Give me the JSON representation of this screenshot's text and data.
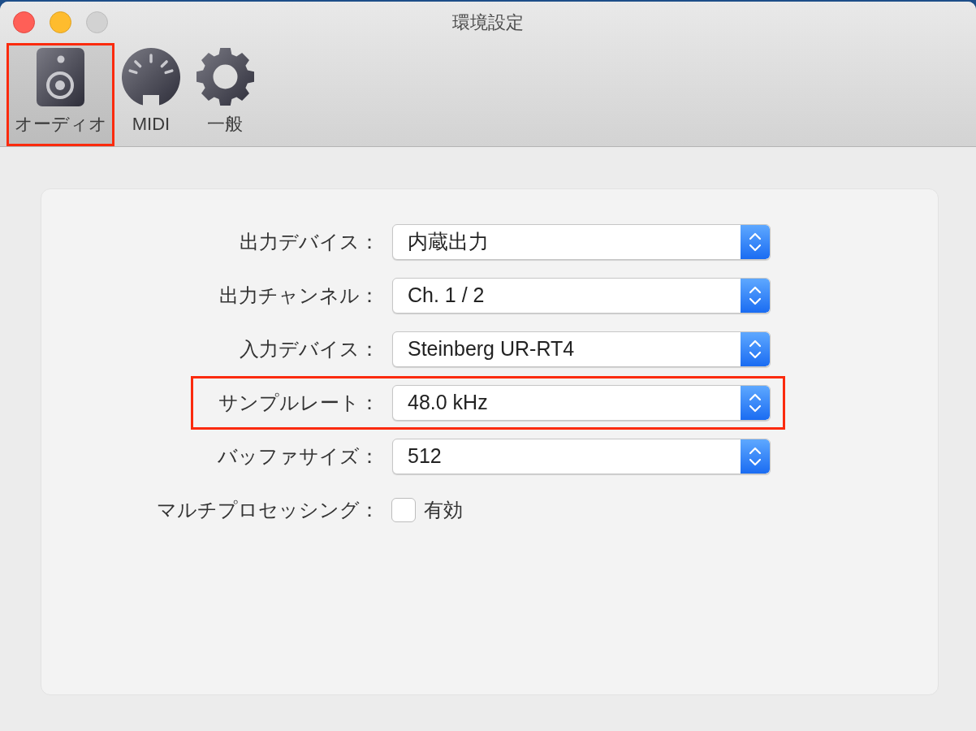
{
  "window": {
    "title": "環境設定",
    "buttons": [
      {
        "kind": "close",
        "disabled": false
      },
      {
        "kind": "minimize",
        "disabled": false
      },
      {
        "kind": "zoom",
        "disabled": true
      }
    ]
  },
  "toolbar": [
    {
      "label": "オーディオ",
      "selected": true,
      "highlighted": true
    },
    {
      "label": "MIDI",
      "selected": false,
      "highlighted": false
    },
    {
      "label": "一般",
      "selected": false,
      "highlighted": false
    }
  ],
  "settings": [
    {
      "kind": "popup",
      "label": "出力デバイス：",
      "value": "内蔵出力",
      "highlighted": false
    },
    {
      "kind": "popup",
      "label": "出力チャンネル：",
      "value": "Ch. 1 / 2",
      "highlighted": false
    },
    {
      "kind": "popup",
      "label": "入力デバイス：",
      "value": "Steinberg UR-RT4",
      "highlighted": false
    },
    {
      "kind": "popup",
      "label": "サンプルレート：",
      "value": "48.0 kHz",
      "highlighted": true
    },
    {
      "kind": "popup",
      "label": "バッファサイズ：",
      "value": "512",
      "highlighted": false
    },
    {
      "kind": "checkbox",
      "label": "マルチプロセッシング：",
      "checked": false,
      "text": "有効",
      "highlighted": false
    }
  ]
}
